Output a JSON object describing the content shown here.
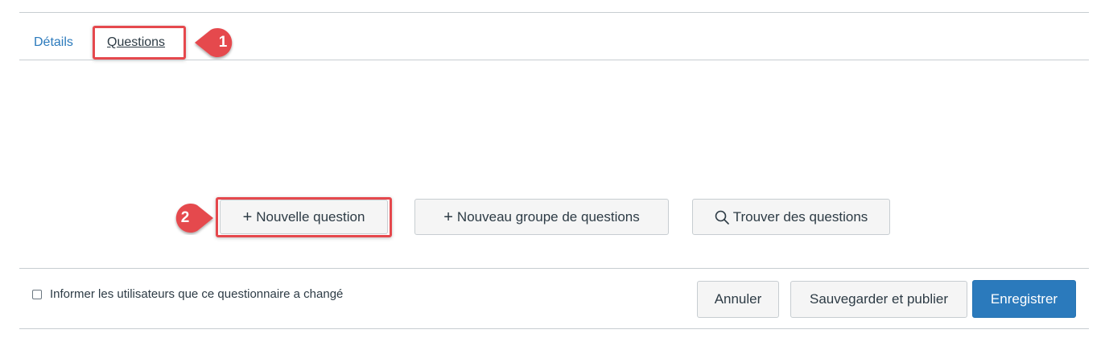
{
  "tabs": [
    {
      "label": "Détails"
    },
    {
      "label": "Questions"
    }
  ],
  "callouts": {
    "first": "1",
    "second": "2"
  },
  "actions": {
    "new_question": "Nouvelle question",
    "new_group": "Nouveau groupe de questions",
    "find_questions": "Trouver des questions"
  },
  "footer": {
    "notify_label": "Informer les utilisateurs que ce questionnaire a changé",
    "notify_checked": false,
    "cancel": "Annuler",
    "save_publish": "Sauvegarder et publier",
    "save": "Enregistrer"
  },
  "colors": {
    "link": "#2b7abc",
    "primary_button": "#2b7abc",
    "highlight": "#e5484d",
    "text": "#2d3b45"
  },
  "icons": {
    "plus": "plus-icon",
    "search": "search-icon"
  }
}
